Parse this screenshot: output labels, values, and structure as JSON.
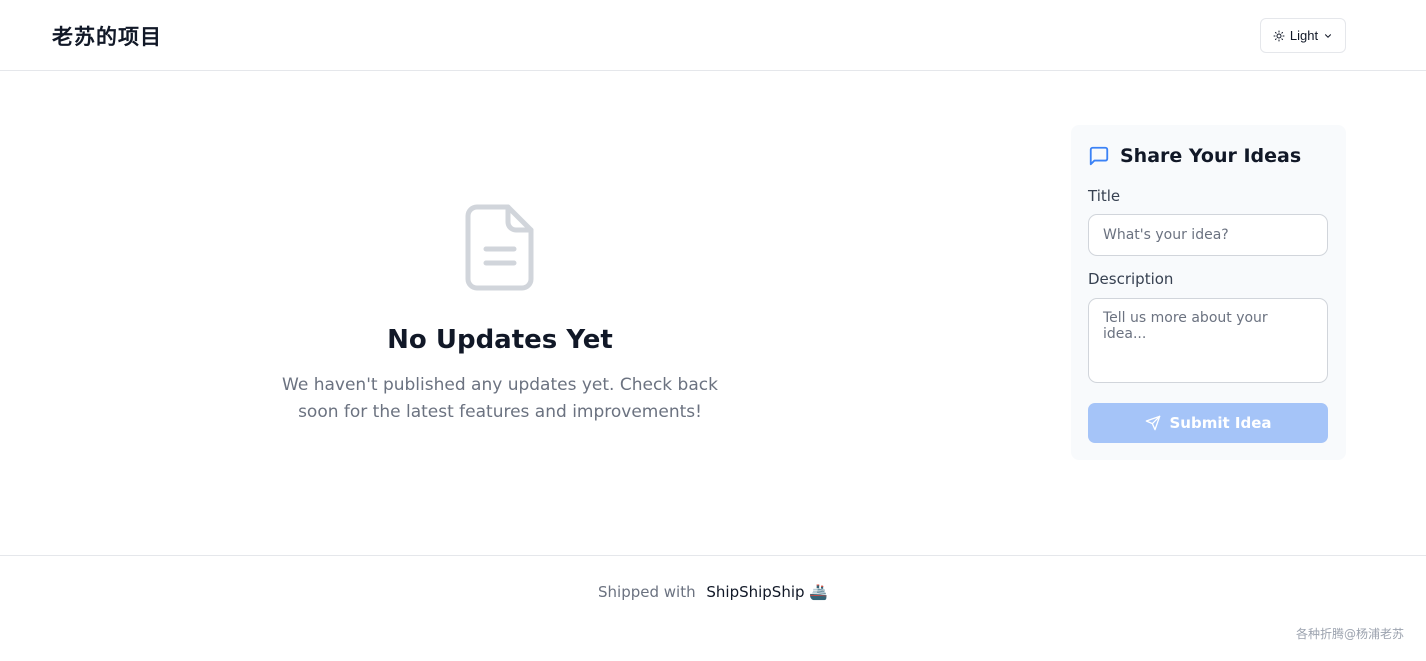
{
  "header": {
    "site_title": "老苏的项目",
    "theme_label": "Light"
  },
  "empty_state": {
    "title": "No Updates Yet",
    "message": "We haven't published any updates yet. Check back soon for the latest features and improvements!"
  },
  "idea_form": {
    "heading": "Share Your Ideas",
    "title_label": "Title",
    "title_placeholder": "What's your idea?",
    "title_value": "",
    "description_label": "Description",
    "description_placeholder": "Tell us more about your idea...",
    "description_value": "",
    "submit_label": "Submit Idea"
  },
  "footer": {
    "shipped_with": "Shipped with",
    "brand": "ShipShipShip",
    "brand_emoji": "🚢"
  },
  "watermark": "各种折腾@杨浦老苏",
  "colors": {
    "accent": "#3b82f6",
    "submit_disabled": "#a5c4f8",
    "card_bg": "#f8fafc",
    "muted_text": "#6b7280"
  }
}
